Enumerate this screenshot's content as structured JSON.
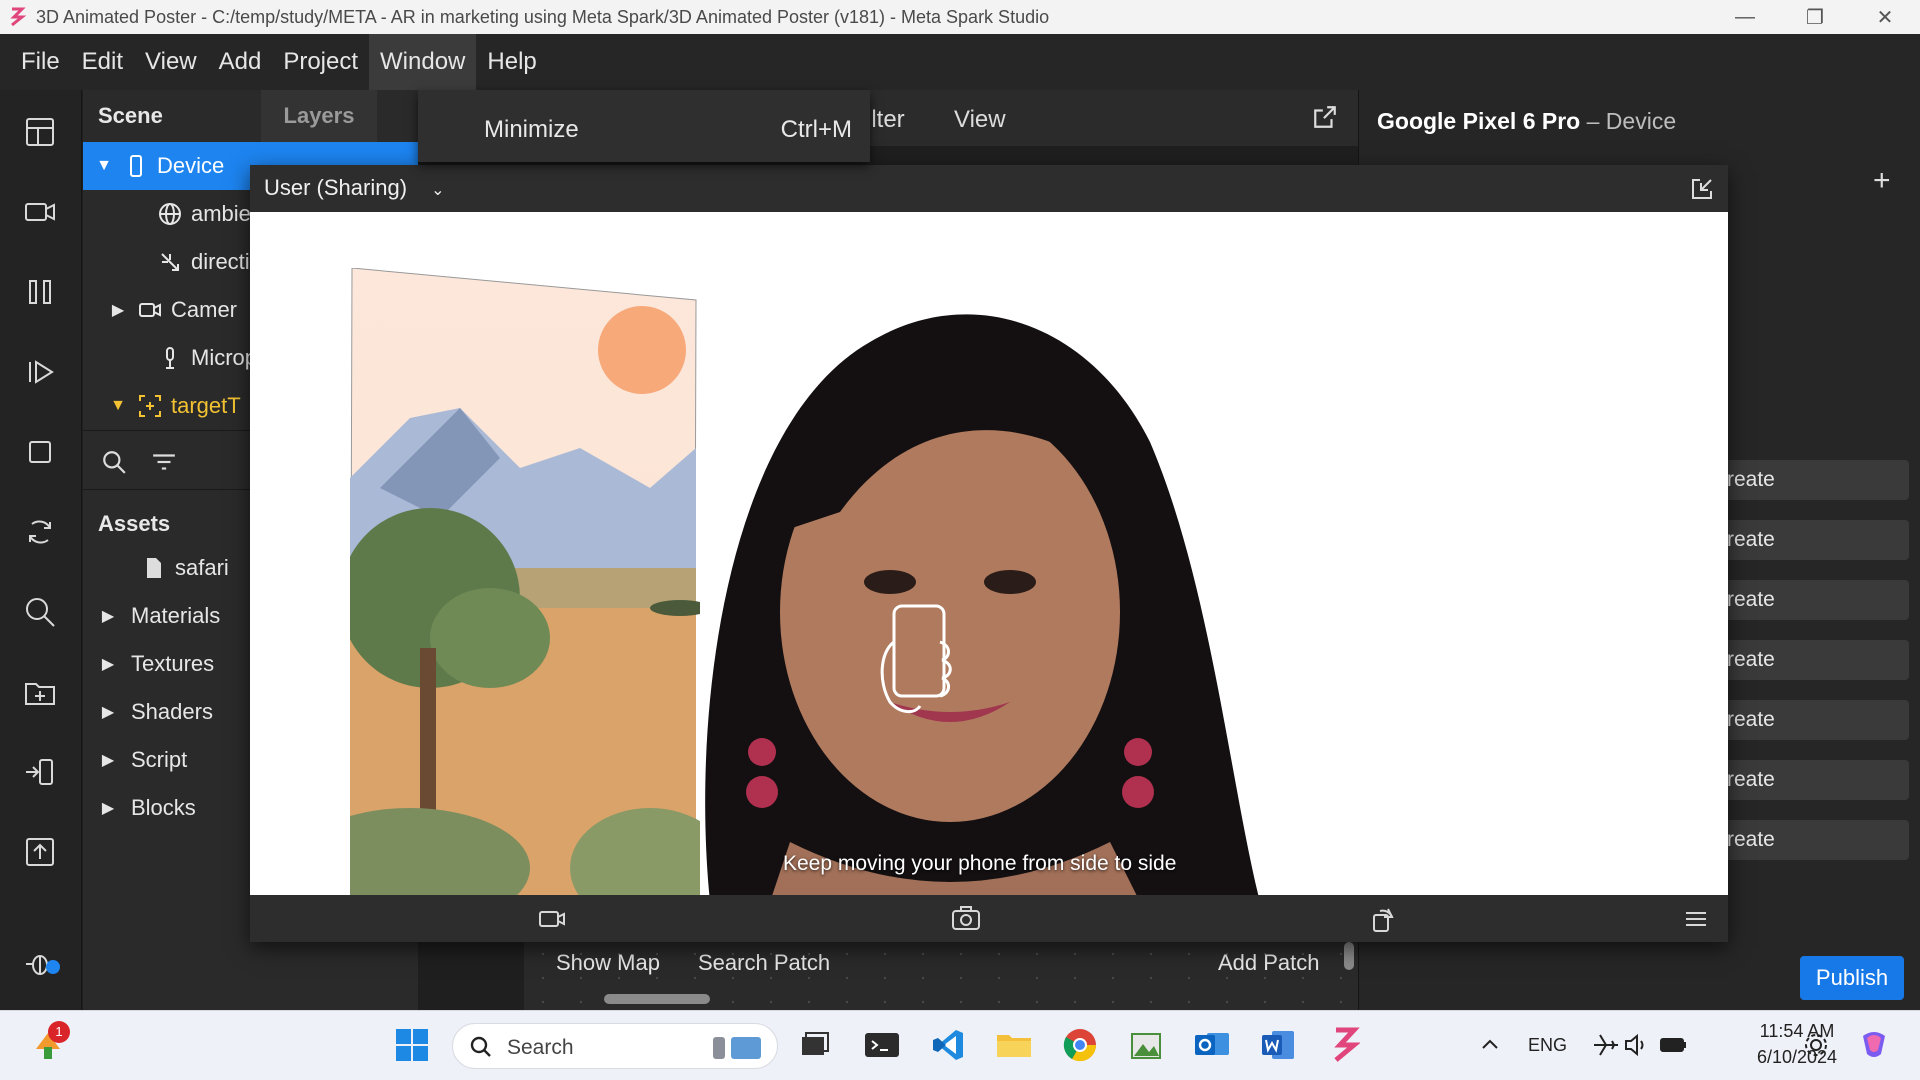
{
  "titlebar": {
    "title": "3D Animated Poster - C:/temp/study/META - AR in marketing using Meta Spark/3D Animated Poster (v181) - Meta Spark Studio",
    "minimize": "—",
    "maximize": "❐",
    "close": "✕"
  },
  "menu": {
    "file": "File",
    "edit": "Edit",
    "view": "View",
    "add": "Add",
    "project": "Project",
    "window": "Window",
    "help": "Help"
  },
  "dropdown": {
    "label": "Minimize",
    "shortcut": "Ctrl+M"
  },
  "scene": {
    "tab_scene": "Scene",
    "tab_layers": "Layers",
    "items": [
      {
        "label": "Device"
      },
      {
        "label": "ambier"
      },
      {
        "label": "directi"
      },
      {
        "label": "Camer"
      },
      {
        "label": "Microp"
      },
      {
        "label": "targetT"
      }
    ]
  },
  "assets": {
    "title": "Assets",
    "items": [
      {
        "label": "safari"
      },
      {
        "label": "Materials"
      },
      {
        "label": "Textures"
      },
      {
        "label": "Shaders"
      },
      {
        "label": "Script"
      },
      {
        "label": "Blocks"
      }
    ]
  },
  "viewport_header": {
    "filter": "ilter",
    "view": "View"
  },
  "simulator": {
    "device_option": "User (Sharing)",
    "hint": "Keep moving your phone from side to side"
  },
  "right_panel": {
    "device_name": "Google Pixel 6 Pro",
    "device_suffix": "– Device",
    "plus": "+",
    "create_label": "reate"
  },
  "patch": {
    "show_map": "Show Map",
    "search_patch": "Search Patch",
    "add_patch": "Add Patch"
  },
  "publish": "Publish",
  "taskbar": {
    "search": "Search",
    "lang": "ENG",
    "time": "11:54 AM",
    "date": "6/10/2024",
    "notif_count": "1"
  }
}
